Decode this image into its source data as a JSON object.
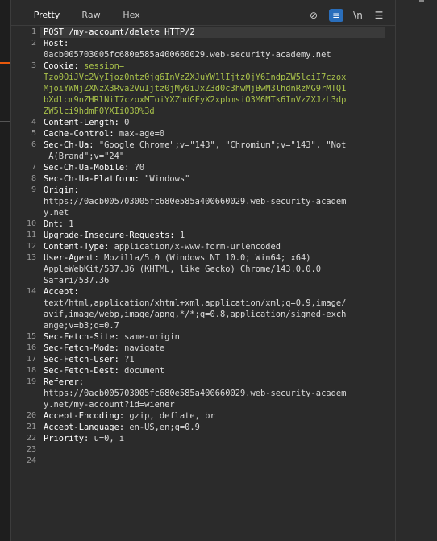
{
  "tabs": [
    {
      "label": "Pretty",
      "active": true
    },
    {
      "label": "Raw",
      "active": false
    },
    {
      "label": "Hex",
      "active": false
    }
  ],
  "toolbar": [
    {
      "icon": "eye-off-icon",
      "glyph": "⊘",
      "active": false
    },
    {
      "icon": "wrap-lines-icon",
      "glyph": "≡",
      "active": true
    },
    {
      "icon": "newline-icon",
      "glyph": "\\n",
      "active": false
    },
    {
      "icon": "menu-icon",
      "glyph": "☰",
      "active": false
    }
  ],
  "colors": {
    "accent": "#e8590c",
    "header_name": "#ffffff",
    "cookie_value": "#a9c24a",
    "text": "#dcdcdc"
  },
  "request": {
    "lines": [
      {
        "num": "1",
        "name": "POST /my-account/delete HTTP/2",
        "value": ""
      },
      {
        "num": "2",
        "name": "Host:",
        "value": ""
      },
      {
        "num": "",
        "name": "",
        "value": "0acb005703005fc680e585a400660029.web-security-academy.net"
      },
      {
        "num": "3",
        "name": "Cookie:",
        "value": "",
        "cookie_name": "session="
      },
      {
        "num": "",
        "name": "",
        "value": "",
        "cookie_cont": "Tzo0OiJVc2VyIjoz0ntz0jg6InVzZXJuYW1lIjtz0jY6IndpZW5lciI7czox"
      },
      {
        "num": "",
        "name": "",
        "value": "",
        "cookie_cont": "MjoiYWNjZXNzX3Rva2VuIjtz0jMy0iJxZ3d0c3hwMjBwM3lhdnRzMG9rMTQ1"
      },
      {
        "num": "",
        "name": "",
        "value": "",
        "cookie_cont": "bXdlcm9nZHRlNiI7czoxMToiYXZhdGFyX2xpbmsiO3M6MTk6InVzZXJzL3dp"
      },
      {
        "num": "",
        "name": "",
        "value": "",
        "cookie_cont": "ZW5lci9hdmF0YXIi030%3d"
      },
      {
        "num": "4",
        "name": "Content-Length:",
        "value": " 0"
      },
      {
        "num": "5",
        "name": "Cache-Control:",
        "value": " max-age=0"
      },
      {
        "num": "6",
        "name": "Sec-Ch-Ua:",
        "value": " \"Google Chrome\";v=\"143\", \"Chromium\";v=\"143\", \"Not"
      },
      {
        "num": "",
        "name": "",
        "value": " A(Brand\";v=\"24\""
      },
      {
        "num": "7",
        "name": "Sec-Ch-Ua-Mobile:",
        "value": " ?0"
      },
      {
        "num": "8",
        "name": "Sec-Ch-Ua-Platform:",
        "value": " \"Windows\""
      },
      {
        "num": "9",
        "name": "Origin:",
        "value": ""
      },
      {
        "num": "",
        "name": "",
        "value": "https://0acb005703005fc680e585a400660029.web-security-academ"
      },
      {
        "num": "",
        "name": "",
        "value": "y.net"
      },
      {
        "num": "10",
        "name": "Dnt:",
        "value": " 1"
      },
      {
        "num": "11",
        "name": "Upgrade-Insecure-Requests:",
        "value": " 1"
      },
      {
        "num": "12",
        "name": "Content-Type:",
        "value": " application/x-www-form-urlencoded"
      },
      {
        "num": "13",
        "name": "User-Agent:",
        "value": " Mozilla/5.0 (Windows NT 10.0; Win64; x64)"
      },
      {
        "num": "",
        "name": "",
        "value": "AppleWebKit/537.36 (KHTML, like Gecko) Chrome/143.0.0.0"
      },
      {
        "num": "",
        "name": "",
        "value": "Safari/537.36"
      },
      {
        "num": "14",
        "name": "Accept:",
        "value": ""
      },
      {
        "num": "",
        "name": "",
        "value": "text/html,application/xhtml+xml,application/xml;q=0.9,image/"
      },
      {
        "num": "",
        "name": "",
        "value": "avif,image/webp,image/apng,*/*;q=0.8,application/signed-exch"
      },
      {
        "num": "",
        "name": "",
        "value": "ange;v=b3;q=0.7"
      },
      {
        "num": "15",
        "name": "Sec-Fetch-Site:",
        "value": " same-origin"
      },
      {
        "num": "16",
        "name": "Sec-Fetch-Mode:",
        "value": " navigate"
      },
      {
        "num": "17",
        "name": "Sec-Fetch-User:",
        "value": " ?1"
      },
      {
        "num": "18",
        "name": "Sec-Fetch-Dest:",
        "value": " document"
      },
      {
        "num": "19",
        "name": "Referer:",
        "value": ""
      },
      {
        "num": "",
        "name": "",
        "value": "https://0acb005703005fc680e585a400660029.web-security-academ"
      },
      {
        "num": "",
        "name": "",
        "value": "y.net/my-account?id=wiener"
      },
      {
        "num": "20",
        "name": "Accept-Encoding:",
        "value": " gzip, deflate, br"
      },
      {
        "num": "21",
        "name": "Accept-Language:",
        "value": " en-US,en;q=0.9"
      },
      {
        "num": "22",
        "name": "Priority:",
        "value": " u=0, i"
      },
      {
        "num": "23",
        "name": "",
        "value": ""
      },
      {
        "num": "24",
        "name": "",
        "value": ""
      }
    ]
  }
}
